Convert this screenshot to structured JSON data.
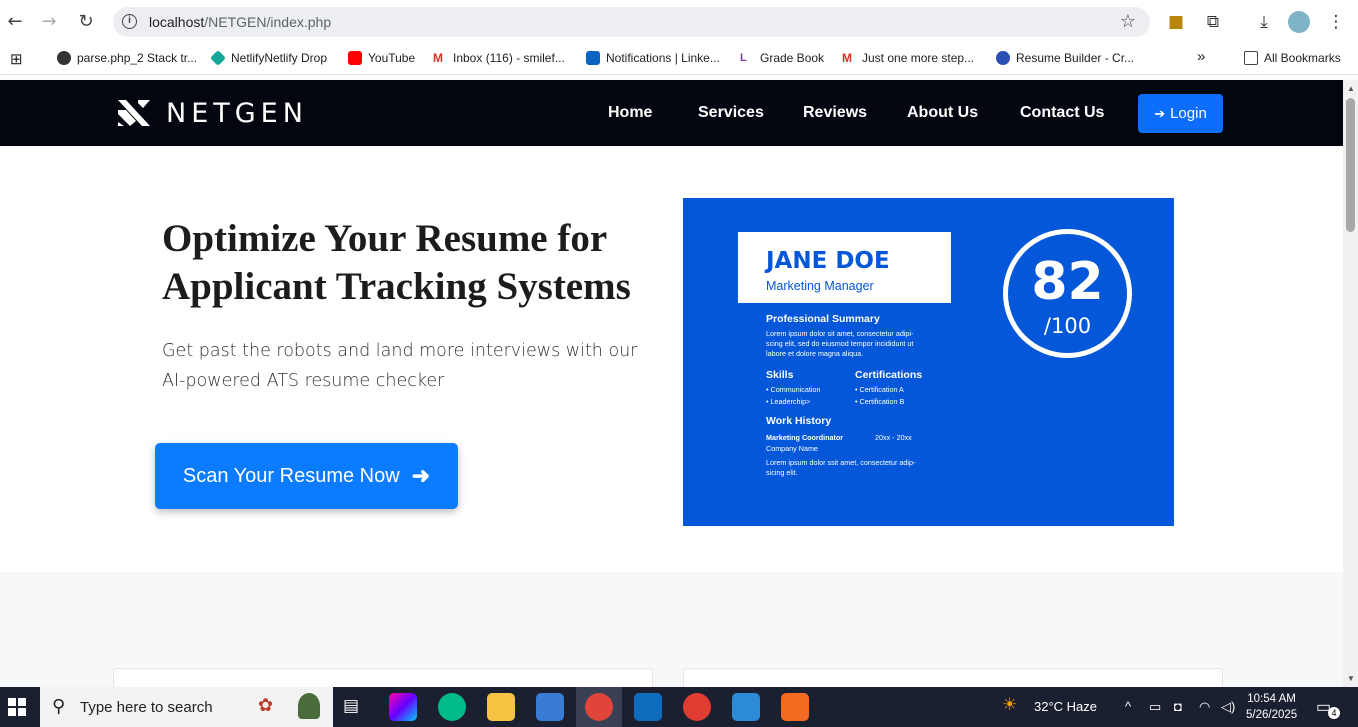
{
  "browser": {
    "url_host": "localhost",
    "url_path": "/NETGEN/index.php",
    "bookmarks": [
      {
        "label": "parse.php_2 Stack tr...",
        "color": "#333333"
      },
      {
        "label": "NetlifyNetlify Drop",
        "color": "#14a89a"
      },
      {
        "label": "YouTube",
        "color": "#ff0000"
      },
      {
        "label": "Inbox (116) - smilef...",
        "color": "#d93025"
      },
      {
        "label": "Notifications | Linke...",
        "color": "#0a66c2"
      },
      {
        "label": "Grade Book",
        "color": "#7b3fa0"
      },
      {
        "label": "Just one more step...",
        "color": "#d93025"
      },
      {
        "label": "Resume Builder - Cr...",
        "color": "#2a4fb5"
      }
    ],
    "all_bookmarks": "All Bookmarks"
  },
  "site": {
    "logo": "NETGEN",
    "nav": [
      "Home",
      "Services",
      "Reviews",
      "About Us",
      "Contact Us"
    ],
    "login": "Login"
  },
  "hero": {
    "title": "Optimize Your Resume for Applicant Tracking Systems",
    "subtitle": "Get past the robots and land more interviews with our AI-powered ATS resume checker",
    "cta": "Scan Your Resume Now"
  },
  "resume": {
    "name": "JANE DOE",
    "role": "Marketing Manager",
    "score": "82",
    "score_den": "/100",
    "summary_h": "Professional Summary",
    "summary_1": "Lorem ipsum dolor sit amet, consectetur adipi-",
    "summary_2": "scing elit, sed do eiusmod tempor incididunt ut",
    "summary_3": "labore et dolore magna aliqua.",
    "skills_h": "Skills",
    "skill_1": "• Communication",
    "skill_2": "• Leaderchip>",
    "cert_h": "Certifications",
    "cert_1": "• Certification A",
    "cert_2": "• Certification B",
    "work_h": "Work History",
    "job_title": "Marketing Coordinator",
    "job_dates": "20xx - 20xx",
    "company": "Company Name",
    "work_1": "Lorem ipsum dolor ssit amet, consectetur adip-",
    "work_2": "sicing elit."
  },
  "taskbar": {
    "search_placeholder": "Type here to search",
    "weather": "32°C  Haze",
    "time": "10:54 AM",
    "date": "5/26/2025",
    "notifications": "4"
  }
}
